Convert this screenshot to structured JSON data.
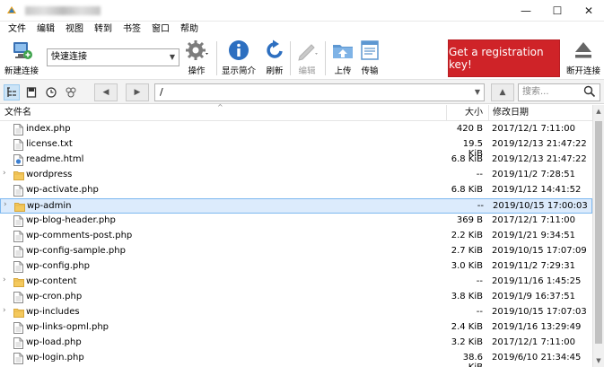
{
  "menu": [
    "文件",
    "编辑",
    "视图",
    "转到",
    "书签",
    "窗口",
    "帮助"
  ],
  "window_controls": {
    "minimize": "—",
    "maximize": "☐",
    "close": "✕"
  },
  "toolbar": {
    "new_connection": "新建连接",
    "quick_connect": "快速连接",
    "action": "操作",
    "info": "显示简介",
    "refresh": "刷新",
    "edit": "编辑",
    "upload": "上传",
    "transfer": "传输",
    "register": "Get a registration key!",
    "disconnect": "断开连接"
  },
  "nav": {
    "path": "/",
    "search_placeholder": "搜索..."
  },
  "columns": {
    "name": "文件名",
    "size": "大小",
    "modified": "修改日期"
  },
  "files": [
    {
      "name": "index.php",
      "size": "420 B",
      "date": "2017/12/1 7:11:00",
      "type": "file",
      "selected": false
    },
    {
      "name": "license.txt",
      "size": "19.5 KiB",
      "date": "2019/12/13 21:47:22",
      "type": "file",
      "selected": false
    },
    {
      "name": "readme.html",
      "size": "6.8 KiB",
      "date": "2019/12/13 21:47:22",
      "type": "html",
      "selected": false
    },
    {
      "name": "wordpress",
      "size": "--",
      "date": "2019/11/2 7:28:51",
      "type": "folder",
      "selected": false
    },
    {
      "name": "wp-activate.php",
      "size": "6.8 KiB",
      "date": "2019/1/12 14:41:52",
      "type": "file",
      "selected": false
    },
    {
      "name": "wp-admin",
      "size": "--",
      "date": "2019/10/15 17:00:03",
      "type": "folder",
      "selected": true
    },
    {
      "name": "wp-blog-header.php",
      "size": "369 B",
      "date": "2017/12/1 7:11:00",
      "type": "file",
      "selected": false
    },
    {
      "name": "wp-comments-post.php",
      "size": "2.2 KiB",
      "date": "2019/1/21 9:34:51",
      "type": "file",
      "selected": false
    },
    {
      "name": "wp-config-sample.php",
      "size": "2.7 KiB",
      "date": "2019/10/15 17:07:09",
      "type": "file",
      "selected": false
    },
    {
      "name": "wp-config.php",
      "size": "3.0 KiB",
      "date": "2019/11/2 7:29:31",
      "type": "file",
      "selected": false
    },
    {
      "name": "wp-content",
      "size": "--",
      "date": "2019/11/16 1:45:25",
      "type": "folder",
      "selected": false
    },
    {
      "name": "wp-cron.php",
      "size": "3.8 KiB",
      "date": "2019/1/9 16:37:51",
      "type": "file",
      "selected": false
    },
    {
      "name": "wp-includes",
      "size": "--",
      "date": "2019/10/15 17:07:03",
      "type": "folder",
      "selected": false
    },
    {
      "name": "wp-links-opml.php",
      "size": "2.4 KiB",
      "date": "2019/1/16 13:29:49",
      "type": "file",
      "selected": false
    },
    {
      "name": "wp-load.php",
      "size": "3.2 KiB",
      "date": "2017/12/1 7:11:00",
      "type": "file",
      "selected": false
    },
    {
      "name": "wp-login.php",
      "size": "38.6 KiB",
      "date": "2019/6/10 21:34:45",
      "type": "file",
      "selected": false
    }
  ],
  "colors": {
    "accent": "#cf2328",
    "selection": "#dcebfc",
    "folder": "#f4c95d"
  }
}
